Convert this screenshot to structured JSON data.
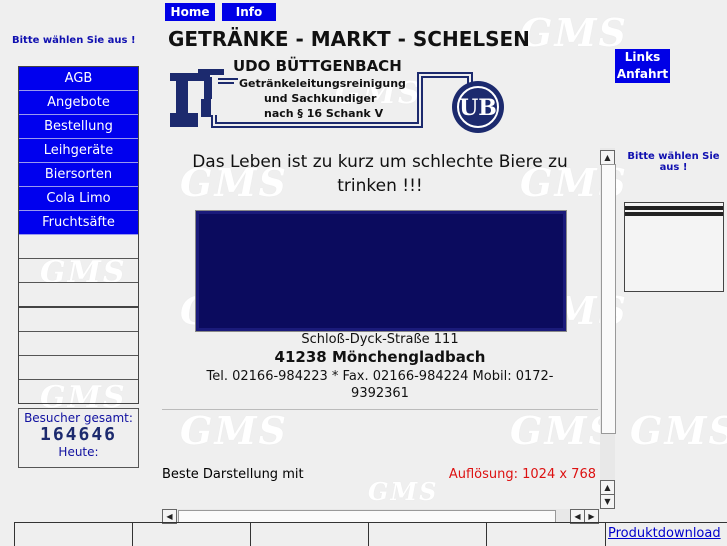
{
  "top_nav": {
    "home": "Home",
    "info": "Info"
  },
  "left_prompt": "Bitte wählen Sie aus !",
  "nav_items": [
    "AGB",
    "Angebote",
    "Bestellung",
    "Leihgeräte",
    "Biersorten",
    "Cola Limo",
    "Fruchtsäfte"
  ],
  "counter": {
    "total_label": "Besucher gesamt:",
    "total_value": "164646",
    "today_label": "Heute:"
  },
  "header_title": "GETRÄNKE - MARKT - SCHELSEN",
  "logo": {
    "owner": "UDO BÜTTGENBACH",
    "line1": "Getränkeleitungsreinigung",
    "line2": "und Sachkundiger",
    "line3": "nach § 16 Schank V",
    "monogram": "UB"
  },
  "right_links": {
    "links": "Links",
    "anfahrt": "Anfahrt"
  },
  "slogan": "Das Leben ist zu kurz um schlechte Biere zu trinken !!!",
  "address": {
    "street": "Schloß-Dyck-Straße 111",
    "city": "41238 Mönchengladbach",
    "contact": "Tel. 02166-984223 * Fax. 02166-984224 Mobil: 0172-9392361"
  },
  "display_note": {
    "label": "Beste Darstellung mit",
    "resolution": "Auflösung: 1024 x 768"
  },
  "right_prompt": "Bitte wählen Sie aus !",
  "watermark": "GMS",
  "footer_link": "Produktdownload",
  "colors": {
    "nav_blue": "#0000ee",
    "accent_red": "#dd1111",
    "dark_box": "#0b0b5e"
  }
}
